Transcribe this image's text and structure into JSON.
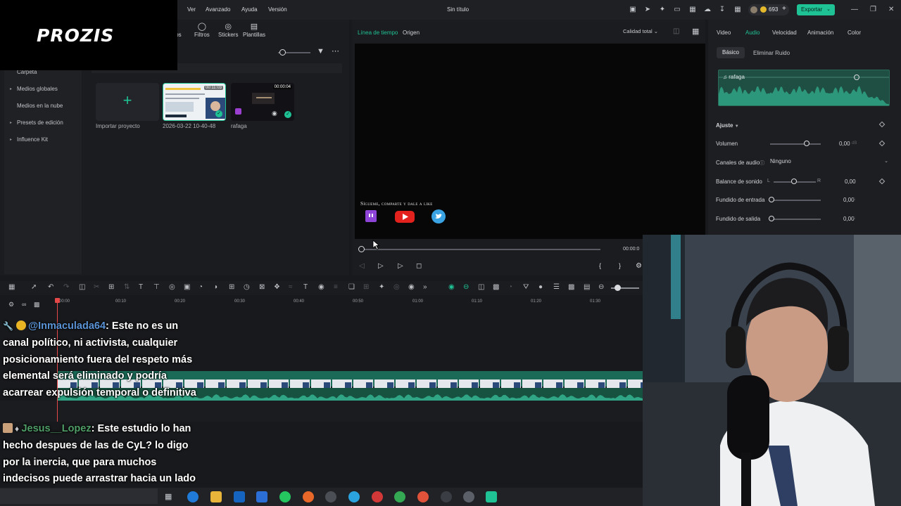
{
  "menubar": {
    "items": [
      "Ver",
      "Avanzado",
      "Ayuda",
      "Versión"
    ],
    "title": "Sin título",
    "credits": "693",
    "export_label": "Exportar"
  },
  "logo": {
    "text": "PROZIS"
  },
  "media": {
    "tool_tabs": [
      "tos",
      "Filtros",
      "Stickers",
      "Plantillas"
    ],
    "sidebar_items": [
      "Carpeta",
      "Medios globales",
      "Medios en la nube",
      "Presets de edición",
      "Influence Kit"
    ],
    "import_label": "Importar proyecto",
    "clips": [
      {
        "name": "2026-03-22 10-40-48",
        "duration": "00:11:03"
      },
      {
        "name": "rafaga",
        "duration": "00:00:04"
      }
    ]
  },
  "preview": {
    "tab_timeline": "Línea de tiempo",
    "tab_origin": "Origen",
    "quality": "Calidad total",
    "follow_text": "Sígueme, comparte y dale a like",
    "time": "00:00:0"
  },
  "props": {
    "tabs": [
      "Video",
      "Audio",
      "Velocidad",
      "Animación",
      "Color"
    ],
    "subtab_basic": "Básico",
    "subtab_noise": "Eliminar Ruido",
    "wave_name": "rafaga",
    "section_adjust": "Ajuste",
    "volume_label": "Volumen",
    "volume_value": "0,00",
    "volume_level": 0.72,
    "volume_unit": "dB",
    "channels_label": "Canales de audio",
    "channels_value": "Ninguno",
    "balance_label": "Balance de sonido",
    "balance_left": "L",
    "balance_right": "R",
    "balance_value": "0,00",
    "fade_in_label": "Fundido de entrada",
    "fade_in_value": "0,00",
    "fade_out_label": "Fundido  de salida",
    "fade_out_value": "0,00",
    "unit_s": "s"
  },
  "timeline": {
    "ticks": [
      "00:00",
      "00:10",
      "00:20",
      "00:30",
      "00:40",
      "00:50",
      "01:00",
      "01:10",
      "01:20",
      "01:30"
    ]
  },
  "chat": {
    "msg1_user": "@Inmaculada64",
    "msg1_text": ": Este no es un canal político, ni activista, cualquier posicionamiento fuera del respeto más elemental será eliminado y podría acarrear expulsión temporal o definitiva",
    "msg2_user": "Jesus__Lopez",
    "msg2_text": ": Este estudio lo han hecho despues de las de CyL? lo digo por la inercia, que para muchos indecisos puede arrastrar hacia un lado u otro de la derecha"
  },
  "colors": {
    "accent": "#1fc295",
    "playhead": "#e54848",
    "user1": "#5b94d6",
    "user2": "#4f9d67"
  }
}
